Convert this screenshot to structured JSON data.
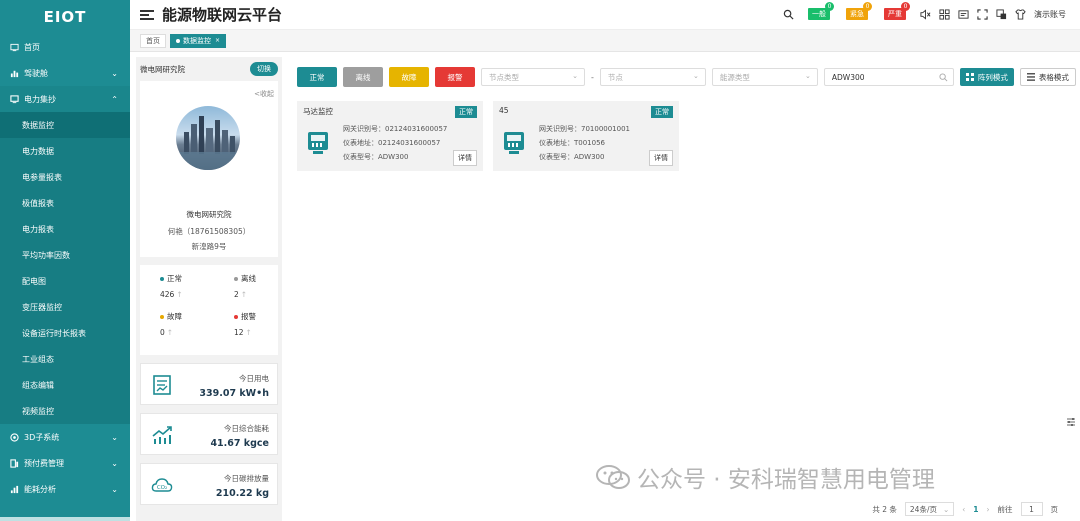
{
  "app": {
    "logo": "EIOT",
    "title": "能源物联网云平台"
  },
  "header": {
    "alarms": [
      {
        "label": "一般",
        "count": "0",
        "color": "#19be6b",
        "dot": "#19be6b"
      },
      {
        "label": "紧急",
        "count": "0",
        "color": "#f0a30a",
        "dot": "#f0a30a"
      },
      {
        "label": "严重",
        "count": "0",
        "color": "#e53935",
        "dot": "#e53935"
      }
    ],
    "account": "演示账号"
  },
  "sidebar": {
    "items": [
      {
        "label": "首页"
      },
      {
        "label": "驾驶舱"
      },
      {
        "label": "电力集抄"
      }
    ],
    "subitems": [
      {
        "label": "数据监控"
      },
      {
        "label": "电力数据"
      },
      {
        "label": "电参量报表"
      },
      {
        "label": "极值报表"
      },
      {
        "label": "电力报表"
      },
      {
        "label": "平均功率因数"
      },
      {
        "label": "配电图"
      },
      {
        "label": "变压器监控"
      },
      {
        "label": "设备运行时长报表"
      },
      {
        "label": "工业组态"
      },
      {
        "label": "组态编辑"
      },
      {
        "label": "视频监控"
      }
    ],
    "bottom_items": [
      {
        "label": "3D子系统"
      },
      {
        "label": "预付费管理"
      },
      {
        "label": "能耗分析"
      }
    ]
  },
  "tabs": [
    {
      "label": "首页"
    },
    {
      "label": "数据监控",
      "close": "×"
    }
  ],
  "info": {
    "org": "微电网研究院",
    "switch_label": "切换",
    "collapse_label": "<收起",
    "name": "微电网研究院",
    "phone": "何艳（18761508305）",
    "address": "新湟路9号",
    "stats": [
      {
        "label": "正常",
        "value": "426",
        "color": "#1d8c93"
      },
      {
        "label": "离线",
        "value": "2",
        "color": "#999999"
      },
      {
        "label": "故障",
        "value": "0",
        "color": "#e6a800"
      },
      {
        "label": "报警",
        "value": "12",
        "color": "#e53935"
      }
    ],
    "up_arrow": "↑",
    "kpis": [
      {
        "label": "今日用电",
        "value": "339.07 kW•h",
        "icon": "report-icon"
      },
      {
        "label": "今日综合能耗",
        "value": "41.67 kgce",
        "icon": "trend-icon"
      },
      {
        "label": "今日碳排放量",
        "value": "210.22 kg",
        "icon": "co2-icon",
        "icon_text": "CO₂"
      }
    ]
  },
  "toolbar": {
    "filters": [
      {
        "label": "正常",
        "color": "#1d8c93"
      },
      {
        "label": "离线",
        "color": "#9e9e9e"
      },
      {
        "label": "故障",
        "color": "#e6b400"
      },
      {
        "label": "报警",
        "color": "#e53935"
      }
    ],
    "node_type_placeholder": "节点类型",
    "dash": "-",
    "node_placeholder": "节点",
    "energy_type_placeholder": "能源类型",
    "search_value": "ADW300",
    "array_mode": "阵列模式",
    "table_mode": "表格模式"
  },
  "cards": [
    {
      "title": "马达监控",
      "status": "正常",
      "gateway": "网关识别号：02124031600057",
      "address": "仪表地址：02124031600057",
      "model": "仪表型号：ADW300",
      "detail": "详情"
    },
    {
      "title": "45",
      "status": "正常",
      "gateway": "网关识别号：70100001001",
      "address": "仪表地址：T001056",
      "model": "仪表型号：ADW300",
      "detail": "详情"
    }
  ],
  "pager": {
    "total": "共 2 条",
    "size": "24条/页",
    "prev": "‹",
    "page": "1",
    "next": "›",
    "goto": "前往",
    "goto_value": "1",
    "page_unit": "页"
  },
  "watermark": {
    "text": "公众号 · 安科瑞智慧用电管理"
  }
}
